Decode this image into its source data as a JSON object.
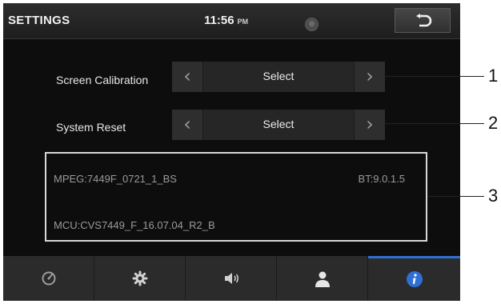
{
  "header": {
    "title": "SETTINGS",
    "time": "11:56",
    "ampm": "PM"
  },
  "rows": [
    {
      "label": "Screen Calibration",
      "value": "Select"
    },
    {
      "label": "System Reset",
      "value": "Select"
    }
  ],
  "info": {
    "mpeg": "MPEG:7449F_0721_1_BS",
    "bt": "BT:9.0.1.5",
    "mcu": "MCU:CVS7449_F_16.07.04_R2_B"
  },
  "tabs": [
    {
      "icon": "gauge-icon",
      "active": false
    },
    {
      "icon": "gear-icon",
      "active": false
    },
    {
      "icon": "speaker-icon",
      "active": false
    },
    {
      "icon": "user-icon",
      "active": false
    },
    {
      "icon": "info-icon",
      "active": true
    }
  ],
  "callouts": [
    "1",
    "2",
    "3"
  ],
  "colors": {
    "accent": "#2f6fd3",
    "background": "#0d0d0d",
    "info_border": "#d8d8d8"
  }
}
